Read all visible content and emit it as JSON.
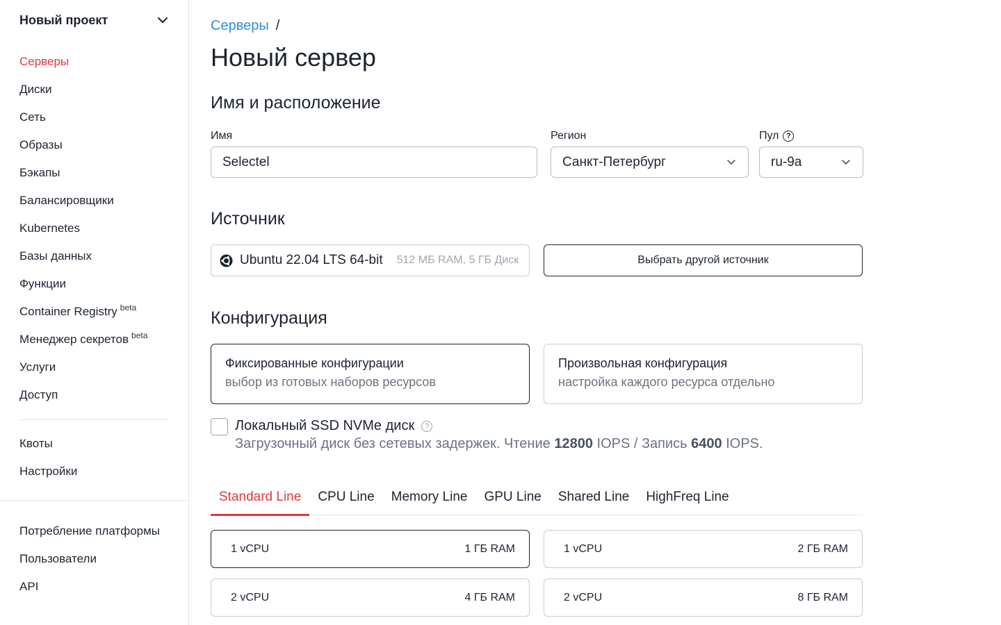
{
  "sidebar": {
    "project": "Новый проект",
    "nav": [
      {
        "label": "Серверы",
        "active": true
      },
      {
        "label": "Диски"
      },
      {
        "label": "Сеть"
      },
      {
        "label": "Образы"
      },
      {
        "label": "Бэкапы"
      },
      {
        "label": "Балансировщики"
      },
      {
        "label": "Kubernetes"
      },
      {
        "label": "Базы данных"
      },
      {
        "label": "Функции"
      },
      {
        "label": "Container Registry",
        "badge": "beta"
      },
      {
        "label": "Менеджер секретов",
        "badge": "beta"
      },
      {
        "label": "Услуги"
      },
      {
        "label": "Доступ"
      }
    ],
    "nav2": [
      "Квоты",
      "Настройки"
    ],
    "nav3": [
      "Потребление платформы",
      "Пользователи",
      "API"
    ]
  },
  "breadcrumb": {
    "link": "Серверы",
    "separator": "/"
  },
  "page_title": "Новый сервер",
  "name_section": {
    "title": "Имя и расположение",
    "name_label": "Имя",
    "name_value": "Selectel",
    "region_label": "Регион",
    "region_value": "Санкт-Петербург",
    "pool_label": "Пул",
    "pool_value": "ru-9a"
  },
  "source_section": {
    "title": "Источник",
    "image_name": "Ubuntu 22.04 LTS 64-bit",
    "image_meta": "512 МБ RAM, 5 ГБ Диск",
    "change_button": "Выбрать другой источник"
  },
  "config_section": {
    "title": "Конфигурация",
    "fixed_title": "Фиксированные конфигурации",
    "fixed_sub": "выбор из готовых наборов ресурсов",
    "custom_title": "Произвольная конфигурация",
    "custom_sub": "настройка каждого ресурса отдельно",
    "ssd_label": "Локальный SSD NVMe диск",
    "ssd_desc_1": "Загрузочный диск без сетевых задержек. Чтение ",
    "ssd_read": "12800",
    "ssd_desc_2": " IOPS / Запись ",
    "ssd_write": "6400",
    "ssd_desc_3": " IOPS.",
    "ssd_checked": false
  },
  "tabs": [
    "Standard Line",
    "CPU Line",
    "Memory Line",
    "GPU Line",
    "Shared Line",
    "HighFreq Line"
  ],
  "active_tab": "Standard Line",
  "configs": [
    {
      "cpu": "1 vCPU",
      "ram": "1 ГБ RAM",
      "selected": true
    },
    {
      "cpu": "1 vCPU",
      "ram": "2 ГБ RAM"
    },
    {
      "cpu": "2 vCPU",
      "ram": "4 ГБ RAM"
    },
    {
      "cpu": "2 vCPU",
      "ram": "8 ГБ RAM"
    }
  ],
  "colors": {
    "accent": "#e3373c",
    "link": "#2f8de4",
    "text": "#1c2430",
    "muted": "#6b7380"
  }
}
